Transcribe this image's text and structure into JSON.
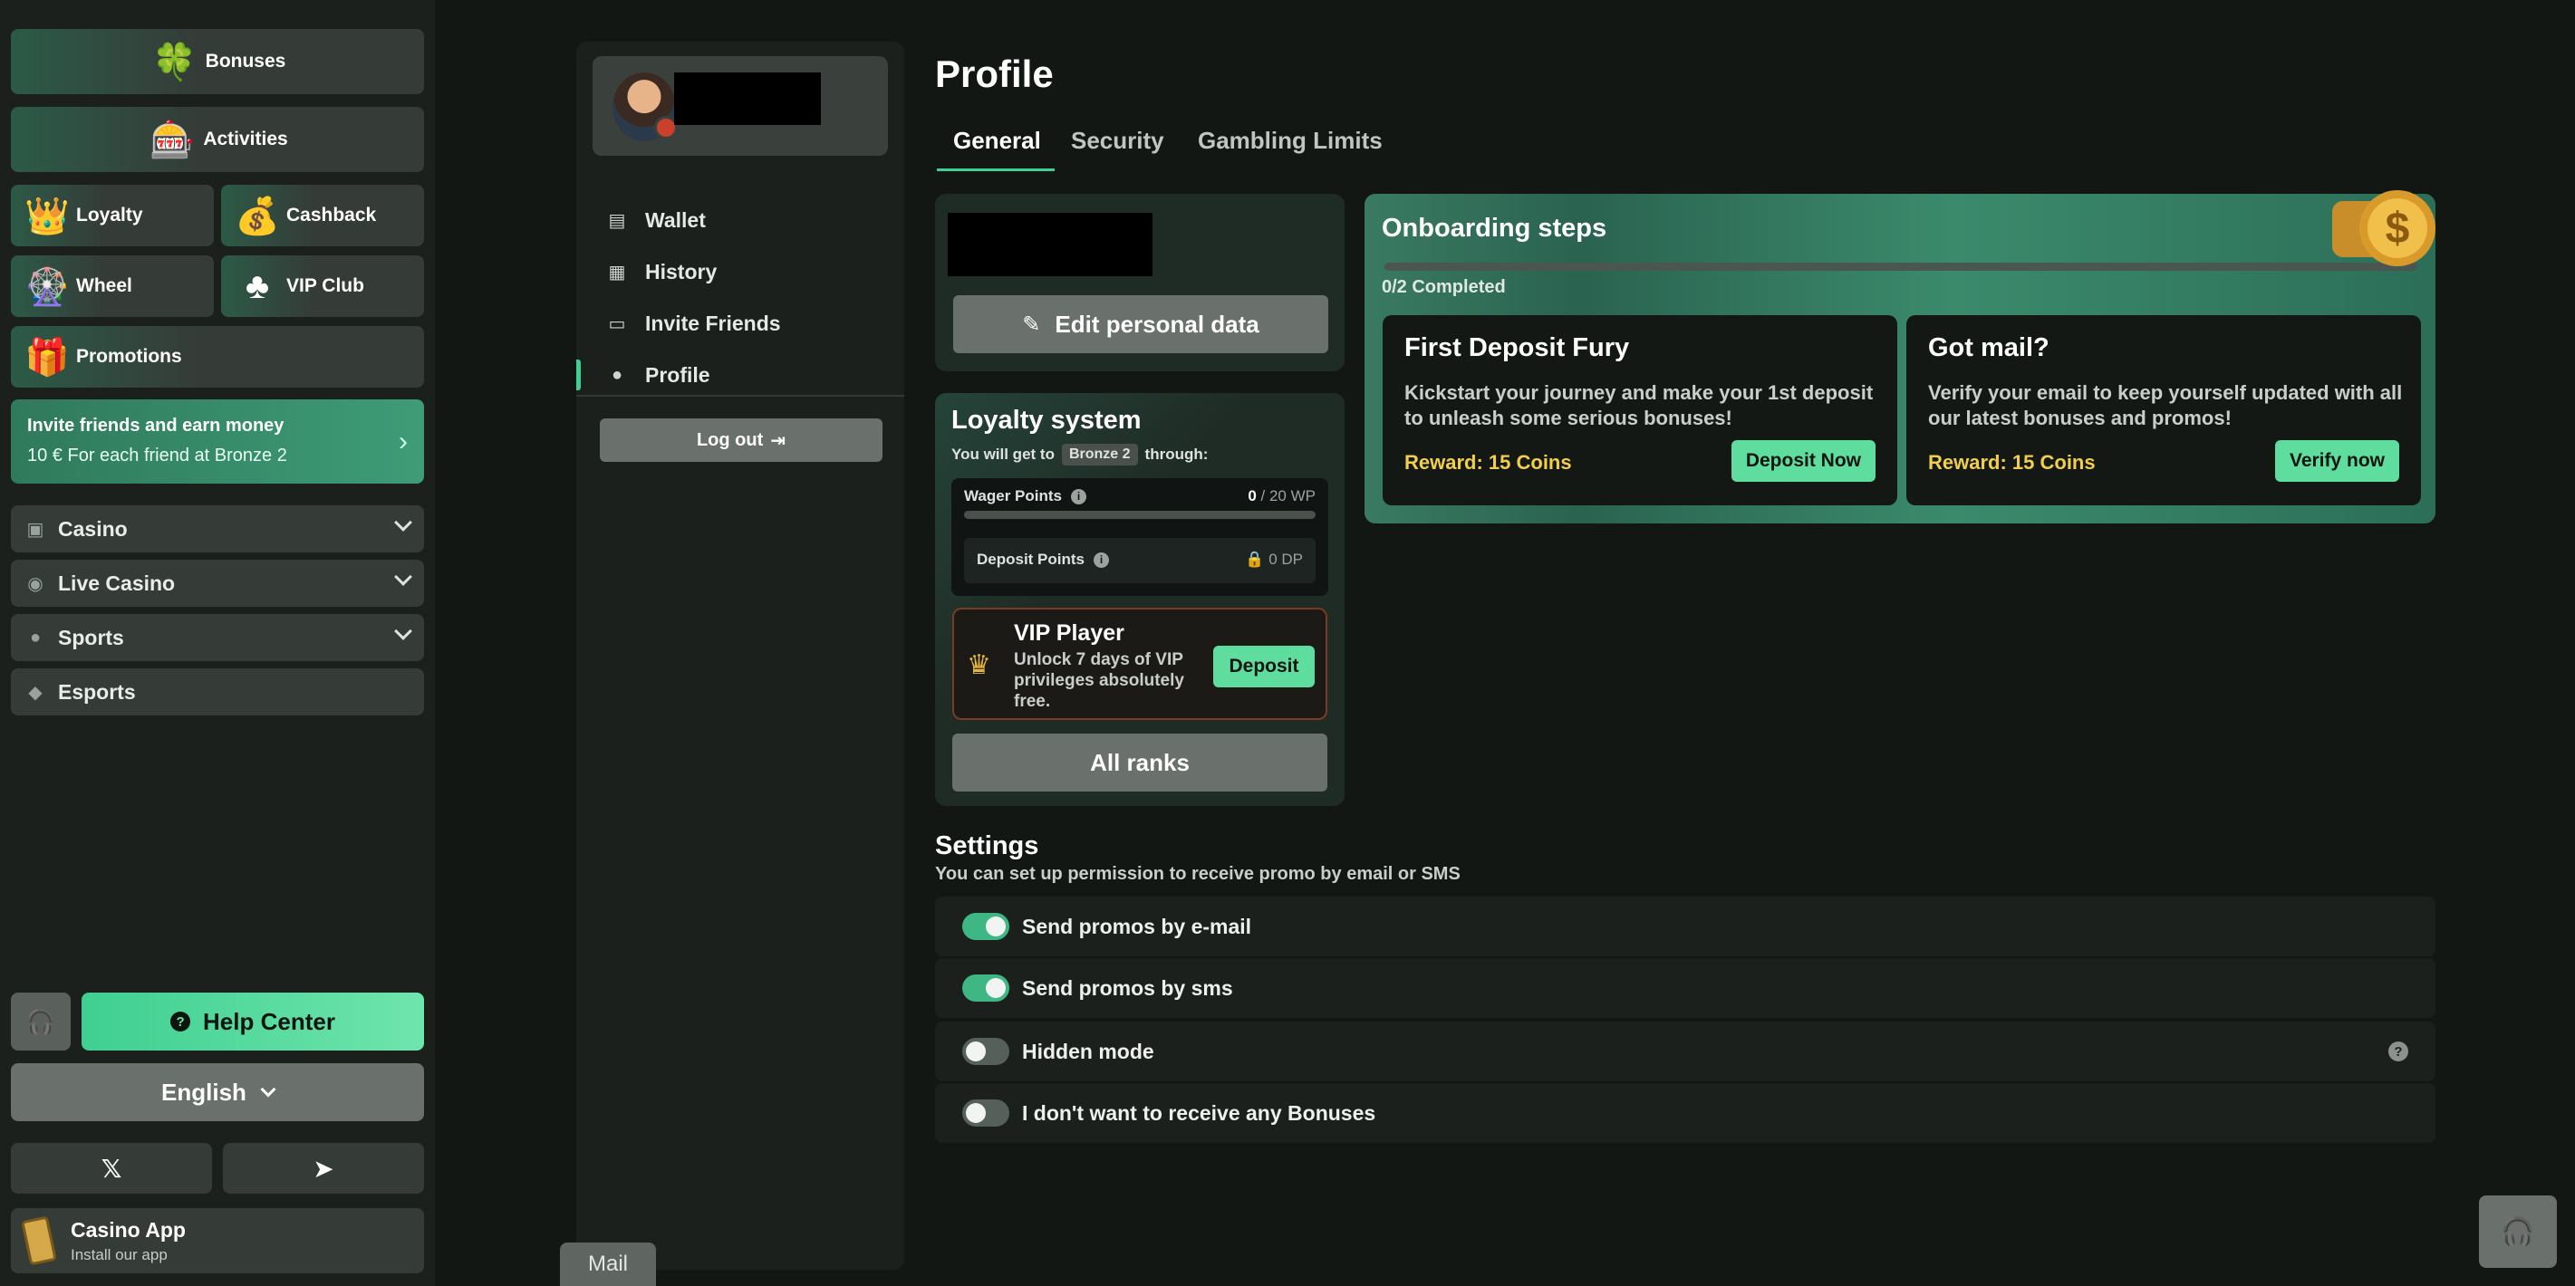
{
  "sidebar": {
    "bonuses": "Bonuses",
    "activities": "Activities",
    "loyalty": "Loyalty",
    "cashback": "Cashback",
    "wheel": "Wheel",
    "vip_club": "VIP Club",
    "promotions": "Promotions",
    "invite_title": "Invite friends and earn money",
    "invite_sub": "10 € For each friend at Bronze 2",
    "categories": [
      "Casino",
      "Live Casino",
      "Sports",
      "Esports"
    ],
    "help_center": "Help Center",
    "language": "English",
    "app_title": "Casino App",
    "app_sub": "Install our app"
  },
  "profile_nav": {
    "items": [
      "Wallet",
      "History",
      "Invite Friends",
      "Profile"
    ],
    "active": "Profile",
    "logout": "Log out",
    "mail_tab": "Mail"
  },
  "main": {
    "title": "Profile",
    "tabs": [
      "General",
      "Security",
      "Gambling Limits"
    ],
    "active_tab": "General",
    "edit_button": "Edit personal data",
    "loyalty": {
      "title": "Loyalty system",
      "sub_prefix": "You will get to",
      "rank": "Bronze 2",
      "sub_suffix": "through:",
      "wager_label": "Wager Points",
      "wager_current": "0",
      "wager_total": "/ 20 WP",
      "wager_progress": 0,
      "deposit_label": "Deposit Points",
      "deposit_value": "0 DP",
      "vip_title": "VIP Player",
      "vip_desc": "Unlock 7 days of VIP privileges absolutely free.",
      "vip_button": "Deposit",
      "all_ranks": "All ranks"
    },
    "onboarding": {
      "title": "Onboarding steps",
      "count": "0/2 Completed",
      "progress": 0,
      "steps": [
        {
          "title": "First Deposit Fury",
          "desc": "Kickstart your journey and make your 1st deposit to unleash some serious bonuses!",
          "reward": "Reward: 15 Coins",
          "button": "Deposit Now"
        },
        {
          "title": "Got mail?",
          "desc": "Verify your email to keep yourself updated with all our latest bonuses and promos!",
          "reward": "Reward: 15 Coins",
          "button": "Verify now"
        }
      ]
    },
    "settings": {
      "title": "Settings",
      "sub": "You can set up permission to receive promo by email or SMS",
      "rows": [
        {
          "label": "Send promos by e-mail",
          "on": true
        },
        {
          "label": "Send promos by sms",
          "on": true
        },
        {
          "label": "Hidden mode",
          "on": false
        },
        {
          "label": "I don't want to receive any Bonuses",
          "on": false
        }
      ]
    }
  },
  "colors": {
    "accent": "#3fcf90",
    "background": "#121714",
    "panel": "#1b201d",
    "reward": "#f2cf4a"
  }
}
